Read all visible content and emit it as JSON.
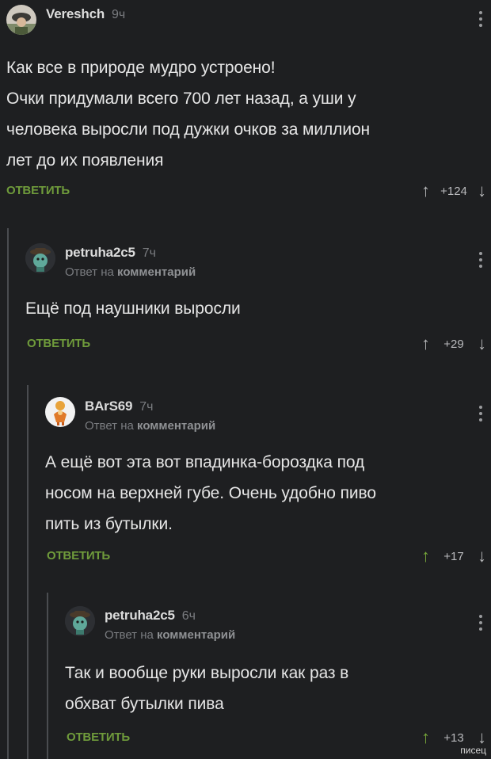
{
  "comments": [
    {
      "username": "Vereshch",
      "time": "9ч",
      "reply_prefix": "",
      "reply_target": "",
      "text_lines": [
        "Как все в природе мудро устроено!",
        "Очки придумали всего 700 лет назад, а уши у",
        "человека выросли под дужки очков за миллион",
        "лет до их появления"
      ],
      "reply_label": "ОТВЕТИТЬ",
      "rating": "+124",
      "upvoted": false
    },
    {
      "username": "petruha2c5",
      "time": "7ч",
      "reply_prefix": "Ответ на",
      "reply_target": "комментарий",
      "text_lines": [
        "Ещё под наушники выросли"
      ],
      "reply_label": "ОТВЕТИТЬ",
      "rating": "+29",
      "upvoted": false
    },
    {
      "username": "BArS69",
      "time": "7ч",
      "reply_prefix": "Ответ на",
      "reply_target": "комментарий",
      "text_lines": [
        "А ещё вот эта вот впадинка-бороздка под",
        "носом на верхней губе. Очень удобно пиво",
        "пить из бутылки."
      ],
      "reply_label": "ОТВЕТИТЬ",
      "rating": "+17",
      "upvoted": true
    },
    {
      "username": "petruha2c5",
      "time": "6ч",
      "reply_prefix": "Ответ на",
      "reply_target": "комментарий",
      "text_lines": [
        "Так и вообще руки выросли как раз в",
        "обхват бутылки пива"
      ],
      "reply_label": "ОТВЕТИТЬ",
      "rating": "+13",
      "upvoted": true
    }
  ],
  "icons": {
    "upvote": "arrow-up-icon",
    "downvote": "arrow-down-icon",
    "menu": "more-vertical-icon"
  },
  "colors": {
    "background": "#1e1f21",
    "accent_green": "#6f9b3b",
    "upvote_active": "#77a83a",
    "thread_line": "#4a4c50"
  },
  "watermark": "писец"
}
